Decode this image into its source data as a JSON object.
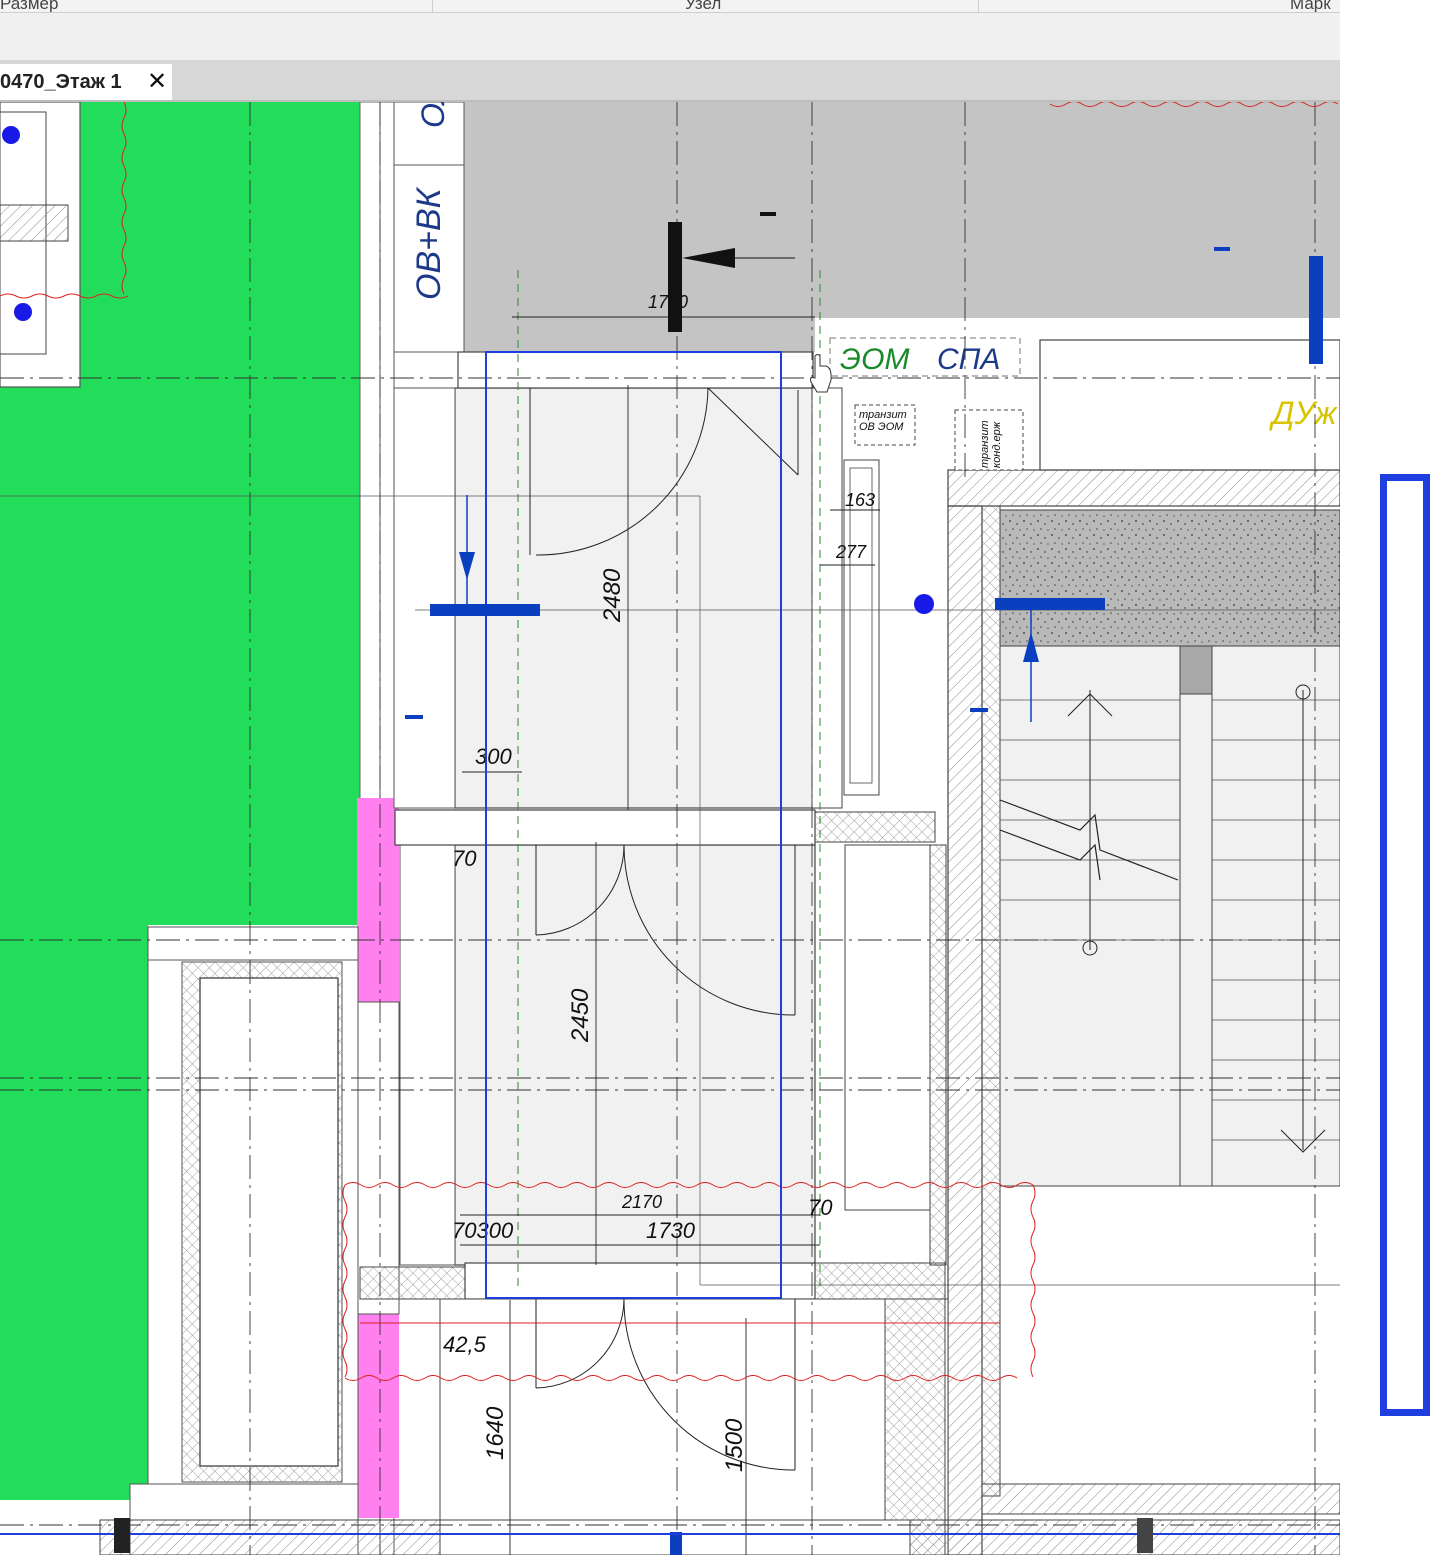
{
  "header": {
    "columns": [
      "Размер",
      "Узел",
      "Марк"
    ]
  },
  "tab": {
    "title": "0470_Этаж 1",
    "close_glyph": "✕"
  },
  "drawing": {
    "labels": {
      "ov_vk": "ОВ+ВК",
      "om": "ОЛ",
      "eom": "ЭОМ",
      "spa": "СПА",
      "duzh": "ДУж",
      "tranzit_ov_eom_1": "транзит",
      "tranzit_ov_eom_2": "ОВ ЭОМ",
      "tranzit_kond_1": "транзит",
      "tranzit_kond_2": "конд.ерж"
    },
    "dimensions": {
      "d1750": "1750",
      "d2480": "2480",
      "d300a": "300",
      "d70a": "70",
      "d163": "163",
      "d277": "277",
      "d2450": "2450",
      "d2170": "2170",
      "d70300": "70300",
      "d1730": "1730",
      "d70b": "70",
      "d42_5": "42,5",
      "d1640": "1640",
      "d1500": "1500"
    },
    "colors": {
      "green_zone": "#22dd5a",
      "magenta": "#ff80ee",
      "blue_frame": "#1f3ee0",
      "section_blue": "#0a3fbf",
      "revision_red": "#e02020",
      "grey_fill": "#c4c4c4"
    }
  }
}
